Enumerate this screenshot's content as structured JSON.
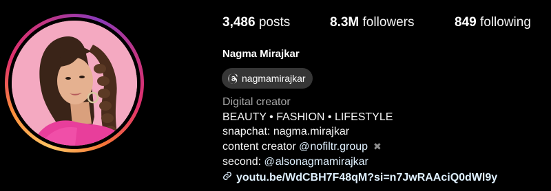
{
  "stats": {
    "posts": {
      "count": "3,486",
      "label": "posts"
    },
    "followers": {
      "count": "8.3M",
      "label": "followers"
    },
    "following": {
      "count": "849",
      "label": "following"
    }
  },
  "profile": {
    "full_name": "Nagma Mirajkar",
    "threads_handle": "nagmamirajkar",
    "category": "Digital creator",
    "bio": {
      "line1": "BEAUTY • FASHION • LIFESTYLE",
      "line2": "snapchat: nagma.mirajkar",
      "line3_prefix": "content creator ",
      "line3_mention": "nofiltr.group",
      "line4_prefix": "second: ",
      "line4_mention": "alsonagmamirajkar"
    },
    "link": "youtu.be/WdCBH7F48qM?si=n7JwRAAciQ0dWl9y"
  },
  "icons": {
    "threads": "threads-icon",
    "mention": "threads-mention-icon",
    "remove": "close-icon",
    "link": "link-icon"
  },
  "colors": {
    "background": "#000000",
    "pill": "#363636",
    "link": "#e0f1ff",
    "secondary_text": "#a8a8a8"
  }
}
